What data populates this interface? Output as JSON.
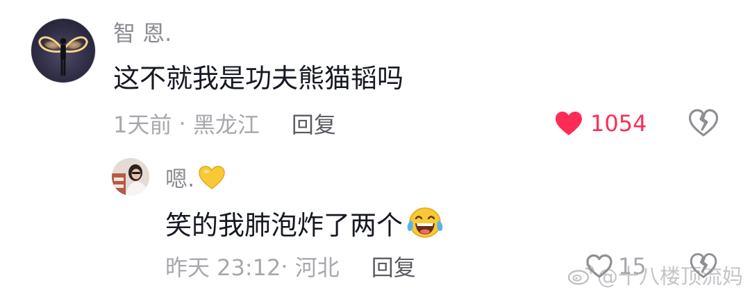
{
  "comment": {
    "username": "智 恩.",
    "text": "这不就我是功夫熊猫韬吗",
    "time": "1天前",
    "separator": " · ",
    "location": "黑龙江",
    "reply_label": "回复",
    "like_count": "1054",
    "liked": true,
    "icons": {
      "avatar": "angel-wings-avatar",
      "like": "heart-filled-icon",
      "dislike": "broken-heart-icon"
    }
  },
  "reply": {
    "username": "嗯.",
    "text": "笑的我肺泡炸了两个",
    "time": "昨天 23:12",
    "separator": "· ",
    "location": "河北",
    "reply_label": "回复",
    "like_count": "15",
    "liked": false,
    "icons": {
      "avatar": "person-photo-avatar",
      "username_badge": "yellow-heart-emoji",
      "text_emoji": "tears-of-joy-emoji",
      "like": "heart-outline-icon",
      "dislike": "broken-heart-icon"
    }
  },
  "watermark": {
    "text": "@十八楼顶流妈",
    "icon": "weibo-logo"
  },
  "colors": {
    "like_active": "#fe2c55",
    "muted_text": "#a7a8ad",
    "username_text": "#8a8b91",
    "body_text": "#161823",
    "reply_button": "#5a5b63",
    "emoji_yellow": "#f9c935"
  }
}
